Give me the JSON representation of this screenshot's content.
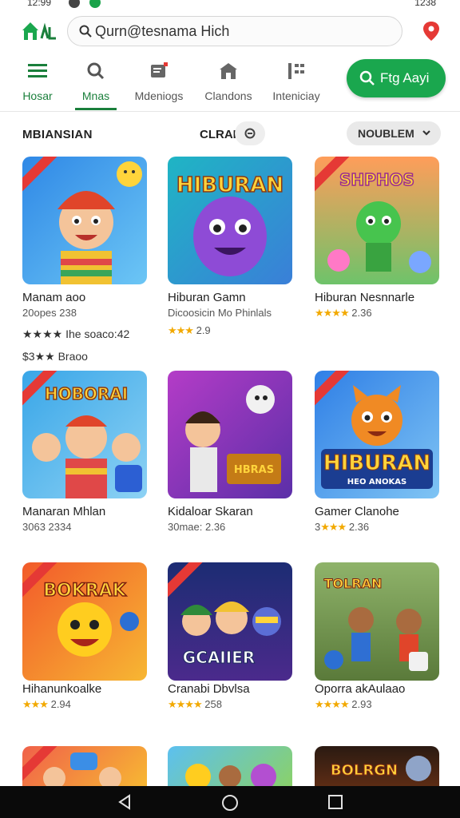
{
  "status_bar": {
    "time_left": "12:99",
    "time_right": "1238"
  },
  "search": {
    "value": "Qurn@tesnama Hich"
  },
  "nav": {
    "items": [
      {
        "label": "Hosar",
        "icon": "menu-icon"
      },
      {
        "label": "Mnas",
        "icon": "search-icon"
      },
      {
        "label": "Mdeniogs",
        "icon": "tablet-icon"
      },
      {
        "label": "Clandons",
        "icon": "store-icon"
      },
      {
        "label": "Inteniciay",
        "icon": "grid-icon"
      }
    ],
    "cta_label": "Ftg Aayi"
  },
  "filters": {
    "left": "MBIANSIAN",
    "mid": "CLRAK",
    "dropdown": "NOUBLEM"
  },
  "games": [
    {
      "title": "Manam aoo",
      "sub_prefix": "",
      "sub": "20opes 238",
      "stars": "",
      "extra1": "★★★★ Ihe soaco:42",
      "extra2": "$3★★ Braoo"
    },
    {
      "title": "Hiburan Gamn",
      "sub_prefix": "",
      "sub": "Dicoosicin Mo Phinlals",
      "stars": "★★★",
      "rating": "2.9"
    },
    {
      "title": "Hiburan Nesnnarle",
      "sub_prefix": "",
      "sub": "",
      "stars": "★★★★",
      "rating": "2.36"
    },
    {
      "title": "Manaran Mhlan",
      "sub_prefix": "",
      "sub": "3063 2334",
      "stars": "",
      "rating": ""
    },
    {
      "title": "Kidaloar Skaran",
      "sub_prefix": "",
      "sub": "30mae: 2.36",
      "stars": "",
      "rating": ""
    },
    {
      "title": "Gamer Clanohe",
      "sub_prefix": "3",
      "sub": "",
      "stars": "★★★",
      "rating": "2.36"
    },
    {
      "title": "Hihanunkoalke",
      "sub_prefix": "",
      "sub": "",
      "stars": "★★★",
      "rating": "2.94"
    },
    {
      "title": "Cranabi Dbvlsa",
      "sub_prefix": "",
      "sub": "",
      "stars": "★★★★",
      "rating": "258"
    },
    {
      "title": "Oporra akAulaao",
      "sub_prefix": "",
      "sub": "",
      "stars": "★★★★",
      "rating": "2.93"
    }
  ],
  "thumb_text": [
    "",
    "HIBURAN",
    "SHPHOS",
    "HOBORAI",
    "",
    "HIBURAN",
    "BOKRAK",
    "GCAIIER",
    "TOLRAN",
    "",
    "",
    "BOLRGN"
  ],
  "thumb_subtext": {
    "t5": "HBRAS",
    "t6": "HEO ANOKAS"
  },
  "colors": {
    "accent": "#1aa74e",
    "nav_active": "#1a7f3b",
    "star": "#f2a900"
  }
}
